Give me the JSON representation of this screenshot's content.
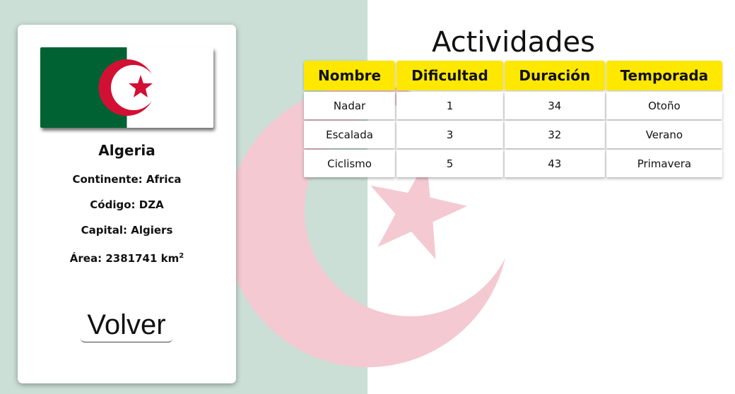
{
  "country": {
    "name": "Algeria",
    "continent_label": "Continente: Africa",
    "code_label": "Código: DZA",
    "capital_label": "Capital: Algiers",
    "area_label": "Área: 2381741 km",
    "area_unit_exponent": "2"
  },
  "flag": {
    "green": "#006233",
    "white": "#ffffff",
    "red": "#d21034"
  },
  "volver_label": "Volver",
  "activities": {
    "title": "Actividades",
    "headers": [
      "Nombre",
      "Dificultad",
      "Duración",
      "Temporada"
    ],
    "rows": [
      [
        "Nadar",
        "1",
        "34",
        "Otoño"
      ],
      [
        "Escalada",
        "3",
        "32",
        "Verano"
      ],
      [
        "Ciclismo",
        "5",
        "43",
        "Primavera"
      ]
    ],
    "header_color": "#ffe800"
  },
  "background": {
    "left_color": "#cbdfd6",
    "emblem_color": "#f4c9d2"
  }
}
